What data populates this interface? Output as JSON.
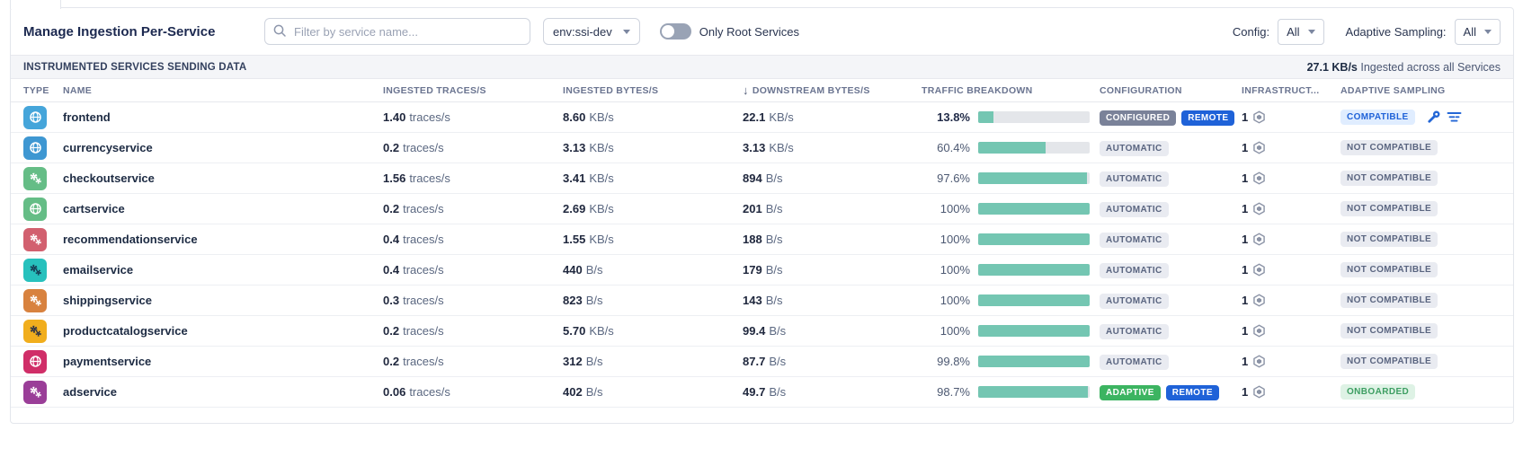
{
  "toolbar": {
    "title": "Manage Ingestion Per-Service",
    "search_placeholder": "Filter by service name...",
    "env_value": "env:ssi-dev",
    "toggle_label": "Only Root Services",
    "config_label": "Config:",
    "config_value": "All",
    "adaptive_label": "Adaptive Sampling:",
    "adaptive_value": "All"
  },
  "section": {
    "title": "INSTRUMENTED SERVICES SENDING DATA",
    "total_rate": "27.1 KB/s",
    "total_suffix": "Ingested across all Services"
  },
  "theme": {
    "bar_fill": "#74c6b2",
    "bar_track": "#e4e6ea",
    "badge_slate": "#7a8299",
    "badge_blue": "#1f62d8",
    "badge_green": "#3cb461",
    "badge_gray_bg": "#e9ebf1",
    "badge_blue_light_bg": "#e0edff",
    "badge_green_light_bg": "#def2e5",
    "accent_blue": "#1f62d8"
  },
  "table": {
    "columns": [
      "TYPE",
      "NAME",
      "INGESTED TRACES/S",
      "INGESTED BYTES/S",
      "DOWNSTREAM BYTES/S",
      "TRAFFIC BREAKDOWN",
      "CONFIGURATION",
      "INFRASTRUCT...",
      "ADAPTIVE SAMPLING"
    ],
    "sort_column": "DOWNSTREAM BYTES/S",
    "rows": [
      {
        "name": "frontend",
        "icon": "globe",
        "icon_bg": "#45a5da",
        "icon_fg": "#ffffff",
        "traces": "1.40",
        "traces_unit": "traces/s",
        "bytes": "8.60",
        "bytes_unit": "KB/s",
        "downstream": "22.1",
        "downstream_unit": "KB/s",
        "traffic_pct": "13.8%",
        "traffic_value": 13.8,
        "traffic_bold": true,
        "config_badges": [
          {
            "label": "CONFIGURED",
            "style": "slate"
          },
          {
            "label": "REMOTE",
            "style": "blue"
          }
        ],
        "hosts": "1",
        "adaptive": {
          "label": "COMPATIBLE",
          "style": "blue-light"
        },
        "adaptive_icons": true
      },
      {
        "name": "currencyservice",
        "icon": "globe",
        "icon_bg": "#3e97d2",
        "icon_fg": "#ffffff",
        "traces": "0.2",
        "traces_unit": "traces/s",
        "bytes": "3.13",
        "bytes_unit": "KB/s",
        "downstream": "3.13",
        "downstream_unit": "KB/s",
        "traffic_pct": "60.4%",
        "traffic_value": 60.4,
        "traffic_bold": false,
        "config_badges": [
          {
            "label": "AUTOMATIC",
            "style": "gray"
          }
        ],
        "hosts": "1",
        "adaptive": {
          "label": "NOT COMPATIBLE",
          "style": "gray"
        },
        "adaptive_icons": false
      },
      {
        "name": "checkoutservice",
        "icon": "gears",
        "icon_bg": "#65bd86",
        "icon_fg": "#ffffff",
        "traces": "1.56",
        "traces_unit": "traces/s",
        "bytes": "3.41",
        "bytes_unit": "KB/s",
        "downstream": "894",
        "downstream_unit": "B/s",
        "traffic_pct": "97.6%",
        "traffic_value": 97.6,
        "traffic_bold": false,
        "config_badges": [
          {
            "label": "AUTOMATIC",
            "style": "gray"
          }
        ],
        "hosts": "1",
        "adaptive": {
          "label": "NOT COMPATIBLE",
          "style": "gray"
        },
        "adaptive_icons": false
      },
      {
        "name": "cartservice",
        "icon": "globe",
        "icon_bg": "#65bd86",
        "icon_fg": "#ffffff",
        "traces": "0.2",
        "traces_unit": "traces/s",
        "bytes": "2.69",
        "bytes_unit": "KB/s",
        "downstream": "201",
        "downstream_unit": "B/s",
        "traffic_pct": "100%",
        "traffic_value": 100,
        "traffic_bold": false,
        "config_badges": [
          {
            "label": "AUTOMATIC",
            "style": "gray"
          }
        ],
        "hosts": "1",
        "adaptive": {
          "label": "NOT COMPATIBLE",
          "style": "gray"
        },
        "adaptive_icons": false
      },
      {
        "name": "recommendationservice",
        "icon": "gears",
        "icon_bg": "#d2606f",
        "icon_fg": "#ffffff",
        "traces": "0.4",
        "traces_unit": "traces/s",
        "bytes": "1.55",
        "bytes_unit": "KB/s",
        "downstream": "188",
        "downstream_unit": "B/s",
        "traffic_pct": "100%",
        "traffic_value": 100,
        "traffic_bold": false,
        "config_badges": [
          {
            "label": "AUTOMATIC",
            "style": "gray"
          }
        ],
        "hosts": "1",
        "adaptive": {
          "label": "NOT COMPATIBLE",
          "style": "gray"
        },
        "adaptive_icons": false
      },
      {
        "name": "emailservice",
        "icon": "gears",
        "icon_bg": "#27c1bd",
        "icon_fg": "#163a52",
        "traces": "0.4",
        "traces_unit": "traces/s",
        "bytes": "440",
        "bytes_unit": "B/s",
        "downstream": "179",
        "downstream_unit": "B/s",
        "traffic_pct": "100%",
        "traffic_value": 100,
        "traffic_bold": false,
        "config_badges": [
          {
            "label": "AUTOMATIC",
            "style": "gray"
          }
        ],
        "hosts": "1",
        "adaptive": {
          "label": "NOT COMPATIBLE",
          "style": "gray"
        },
        "adaptive_icons": false
      },
      {
        "name": "shippingservice",
        "icon": "gears",
        "icon_bg": "#d8823f",
        "icon_fg": "#ffffff",
        "traces": "0.3",
        "traces_unit": "traces/s",
        "bytes": "823",
        "bytes_unit": "B/s",
        "downstream": "143",
        "downstream_unit": "B/s",
        "traffic_pct": "100%",
        "traffic_value": 100,
        "traffic_bold": false,
        "config_badges": [
          {
            "label": "AUTOMATIC",
            "style": "gray"
          }
        ],
        "hosts": "1",
        "adaptive": {
          "label": "NOT COMPATIBLE",
          "style": "gray"
        },
        "adaptive_icons": false
      },
      {
        "name": "productcatalogservice",
        "icon": "gears",
        "icon_bg": "#f1ae1d",
        "icon_fg": "#2c3347",
        "traces": "0.2",
        "traces_unit": "traces/s",
        "bytes": "5.70",
        "bytes_unit": "KB/s",
        "downstream": "99.4",
        "downstream_unit": "B/s",
        "traffic_pct": "100%",
        "traffic_value": 100,
        "traffic_bold": false,
        "config_badges": [
          {
            "label": "AUTOMATIC",
            "style": "gray"
          }
        ],
        "hosts": "1",
        "adaptive": {
          "label": "NOT COMPATIBLE",
          "style": "gray"
        },
        "adaptive_icons": false
      },
      {
        "name": "paymentservice",
        "icon": "globe",
        "icon_bg": "#d02e68",
        "icon_fg": "#ffffff",
        "traces": "0.2",
        "traces_unit": "traces/s",
        "bytes": "312",
        "bytes_unit": "B/s",
        "downstream": "87.7",
        "downstream_unit": "B/s",
        "traffic_pct": "99.8%",
        "traffic_value": 99.8,
        "traffic_bold": false,
        "config_badges": [
          {
            "label": "AUTOMATIC",
            "style": "gray"
          }
        ],
        "hosts": "1",
        "adaptive": {
          "label": "NOT COMPATIBLE",
          "style": "gray"
        },
        "adaptive_icons": false
      },
      {
        "name": "adservice",
        "icon": "gears",
        "icon_bg": "#9a3e98",
        "icon_fg": "#ffffff",
        "traces": "0.06",
        "traces_unit": "traces/s",
        "bytes": "402",
        "bytes_unit": "B/s",
        "downstream": "49.7",
        "downstream_unit": "B/s",
        "traffic_pct": "98.7%",
        "traffic_value": 98.7,
        "traffic_bold": false,
        "config_badges": [
          {
            "label": "ADAPTIVE",
            "style": "green"
          },
          {
            "label": "REMOTE",
            "style": "blue"
          }
        ],
        "hosts": "1",
        "adaptive": {
          "label": "ONBOARDED",
          "style": "green-light"
        },
        "adaptive_icons": false
      }
    ]
  }
}
